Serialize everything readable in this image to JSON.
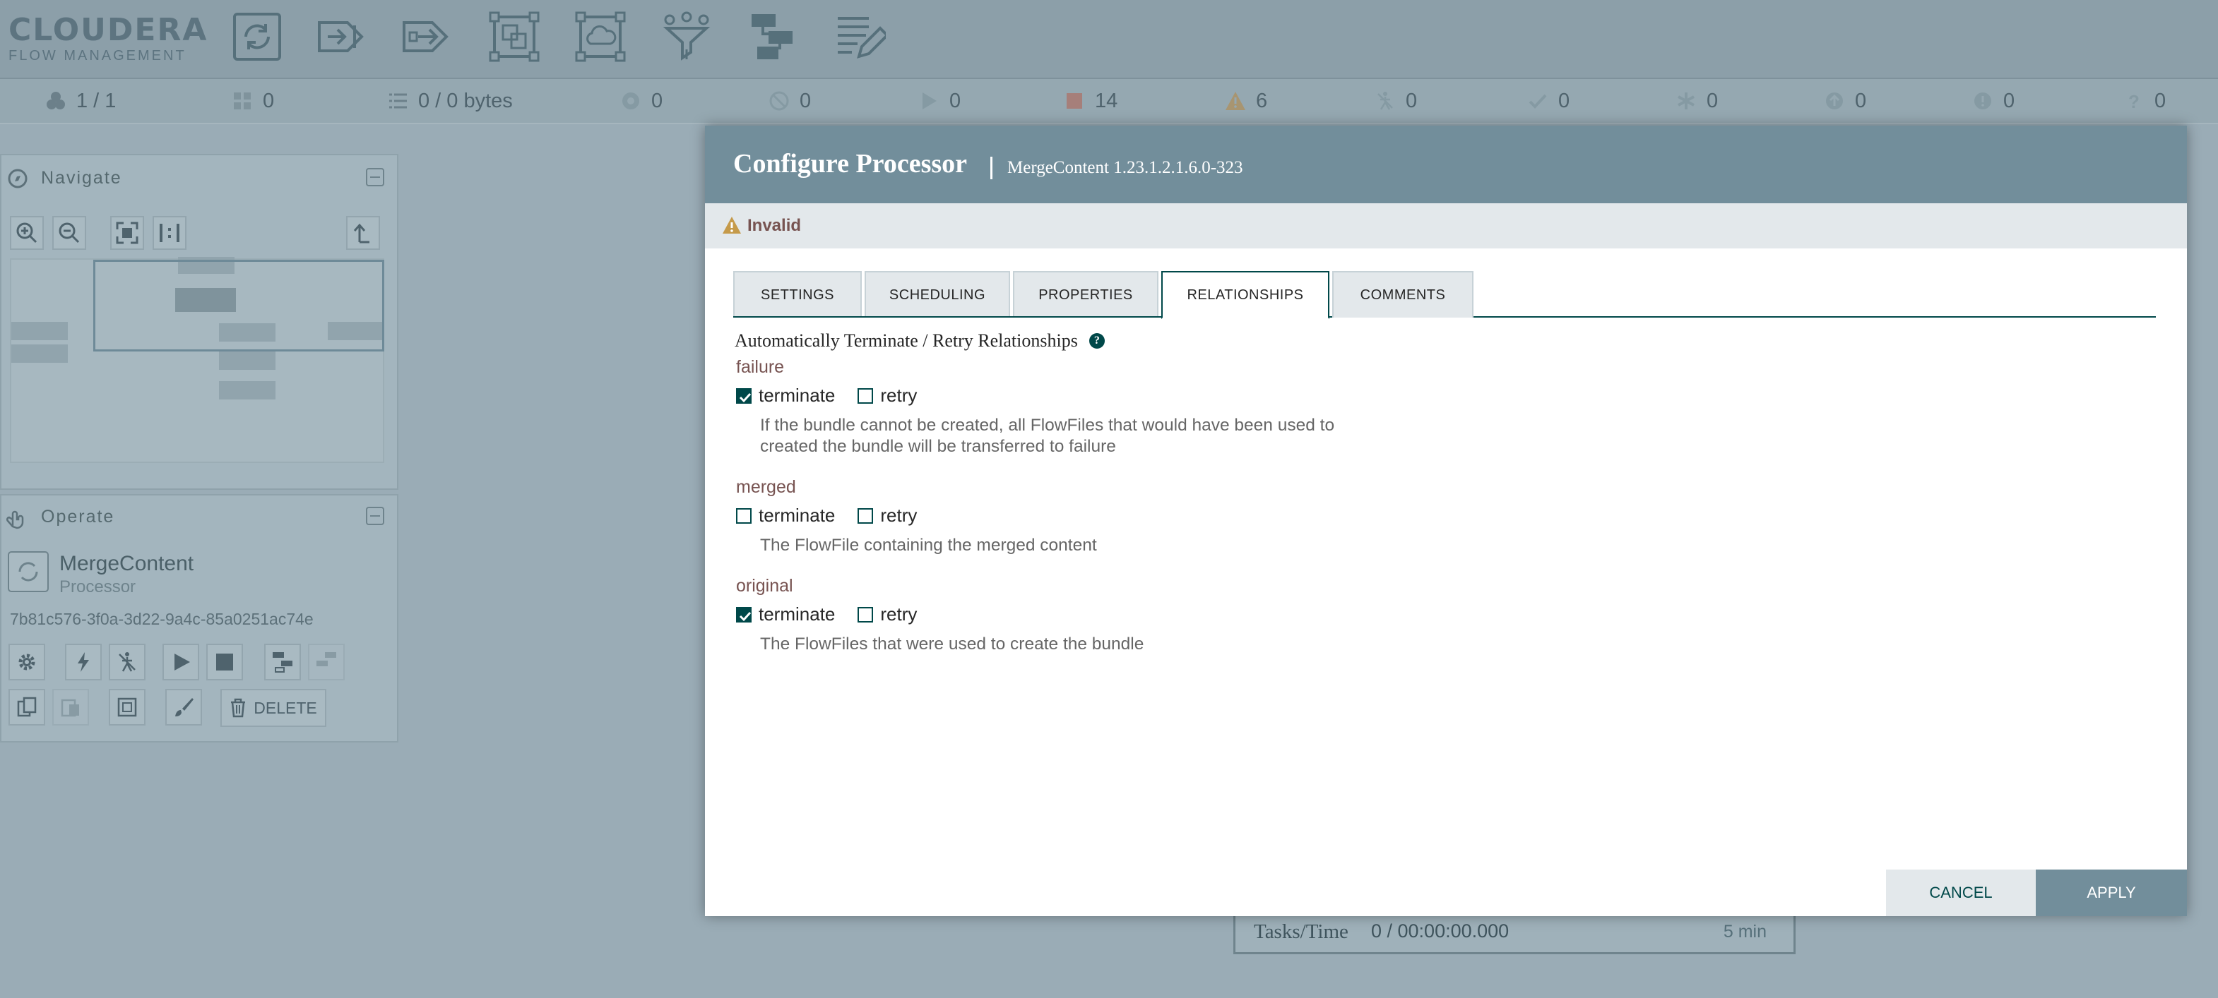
{
  "header": {
    "brand": "CLOUDERA",
    "product": "FLOW MANAGEMENT",
    "toolbar_icons": [
      "processor-icon",
      "input-port-icon",
      "output-port-icon",
      "process-group-icon",
      "remote-process-group-icon",
      "funnel-icon",
      "template-icon",
      "label-icon"
    ]
  },
  "status": {
    "cluster": "1 / 1",
    "threads": "0",
    "queued": "0 / 0 bytes",
    "transmitting": "0",
    "not_transmitting": "0",
    "running": "0",
    "stopped": "14",
    "invalid": "6",
    "disabled": "0",
    "up_to_date": "0",
    "locally_modified": "0",
    "stale": "0",
    "locally_modified_stale": "0",
    "sync_failure": "0"
  },
  "navigate": {
    "title": "Navigate"
  },
  "operate": {
    "title": "Operate",
    "component_name": "MergeContent",
    "component_type": "Processor",
    "component_id": "7b81c576-3f0a-3d22-9a4c-85a0251ac74e",
    "delete_label": "DELETE"
  },
  "background_processor": {
    "tasks_label": "Tasks/Time",
    "tasks_value": "0 / 00:00:00.000",
    "window": "5 min"
  },
  "dialog": {
    "title": "Configure Processor",
    "subtitle": "MergeContent 1.23.1.2.1.6.0-323",
    "status": "Invalid",
    "tabs": [
      "SETTINGS",
      "SCHEDULING",
      "PROPERTIES",
      "RELATIONSHIPS",
      "COMMENTS"
    ],
    "active_tab": "RELATIONSHIPS",
    "relationships_heading": "Automatically Terminate / Retry Relationships",
    "relationships": [
      {
        "name": "failure",
        "terminate": true,
        "retry": false,
        "terminate_label": "terminate",
        "retry_label": "retry",
        "description_line1": "If the bundle cannot be created, all FlowFiles that would have been used to",
        "description_line2": "created the bundle will be transferred to failure"
      },
      {
        "name": "merged",
        "terminate": false,
        "retry": false,
        "terminate_label": "terminate",
        "retry_label": "retry",
        "description_line1": "The FlowFile containing the merged content"
      },
      {
        "name": "original",
        "terminate": true,
        "retry": false,
        "terminate_label": "terminate",
        "retry_label": "retry",
        "description_line1": "The FlowFiles that were used to create the bundle"
      }
    ],
    "cancel_label": "CANCEL",
    "apply_label": "APPLY"
  },
  "colors": {
    "dialog_header": "#728e9b",
    "accent": "#004849",
    "relationship_name": "#775351",
    "warning": "#ba554a"
  }
}
